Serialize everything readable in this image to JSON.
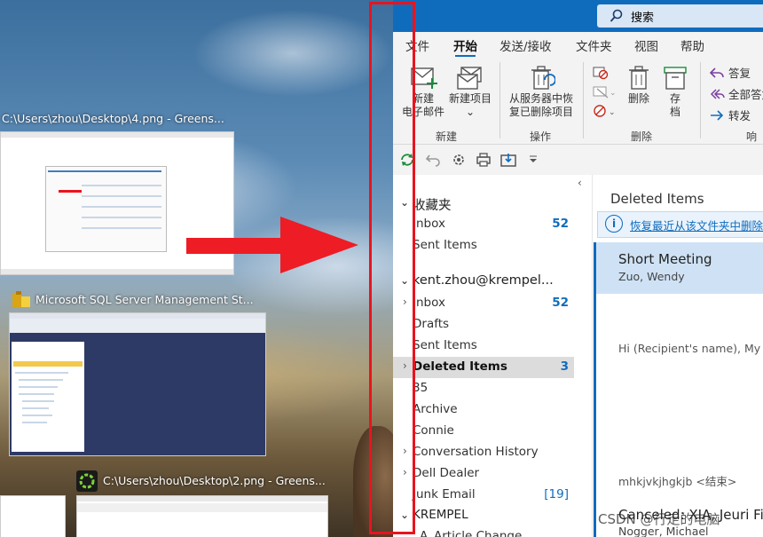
{
  "desktop": {
    "tasks": [
      {
        "title": "C:\\Users\\zhou\\Desktop\\4.png - Greens...",
        "icon": "greenshot-icon"
      },
      {
        "title": "Microsoft SQL Server Management St...",
        "icon": "ssms-icon"
      },
      {
        "title": "C:\\Users\\zhou\\Desktop\\2.png - Greens...",
        "icon": "greenshot-icon"
      }
    ]
  },
  "outlook": {
    "search": {
      "label": "搜索"
    },
    "ribbon_tabs": [
      "文件",
      "开始",
      "发送/接收",
      "文件夹",
      "视图",
      "帮助"
    ],
    "active_tab": "开始",
    "ribbon": {
      "new_email": {
        "line1": "新建",
        "line2": "电子邮件"
      },
      "new_items": {
        "line1": "新建项目",
        "line2": "⌄"
      },
      "group_new": "新建",
      "recover": {
        "line1": "从服务器中恢",
        "line2": "复已删除项目"
      },
      "group_actions": "操作",
      "delete": "删除",
      "archive": {
        "line1": "存",
        "line2": "档"
      },
      "group_delete": "删除",
      "reply": "答复",
      "reply_all": "全部答复",
      "forward": "转发",
      "group_respond": "响应"
    },
    "folders": {
      "favorites_header": "收藏夹",
      "favorites": [
        {
          "name": "Inbox",
          "count": "52"
        },
        {
          "name": "Sent Items",
          "count": ""
        }
      ],
      "account_header": "kent.zhou@krempel...",
      "account_items": [
        {
          "name": "Inbox",
          "count": "52",
          "chev": "›"
        },
        {
          "name": "Drafts",
          "count": "",
          "chev": ""
        },
        {
          "name": "Sent Items",
          "count": "",
          "chev": ""
        },
        {
          "name": "Deleted Items",
          "count": "3",
          "chev": "›"
        },
        {
          "name": "35",
          "count": "",
          "chev": ""
        },
        {
          "name": "Archive",
          "count": "",
          "chev": ""
        },
        {
          "name": "Connie",
          "count": "",
          "chev": ""
        },
        {
          "name": "Conversation History",
          "count": "",
          "chev": "›"
        },
        {
          "name": "Dell Dealer",
          "count": "",
          "chev": "›"
        },
        {
          "name": "Junk Email",
          "count": "[19]",
          "chev": ""
        }
      ],
      "krempel_header": "KREMPEL",
      "krempel_items": [
        {
          "name": "A_Article Change",
          "chev": ""
        }
      ]
    },
    "message_list": {
      "title": "Deleted Items",
      "info_text": "恢复最近从该文件夹中删除的",
      "messages": [
        {
          "subject": "Short Meeting",
          "from": "Zuo, Wendy",
          "preview": "Hi (Recipient's name),  My na"
        },
        {
          "subject": "",
          "from": "",
          "preview": "mhkjvkjhgkjb <结束>"
        },
        {
          "subject": "Canceled: XIA, Jeuri Fix",
          "from": "Nogger, Michael",
          "preview": ""
        }
      ]
    }
  },
  "watermark": "CSDN @行走的电脑"
}
